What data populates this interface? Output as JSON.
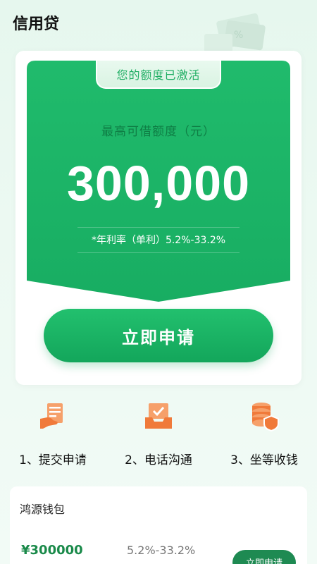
{
  "header": {
    "title": "信用贷"
  },
  "card": {
    "status_tab": "您的额度已激活",
    "limit_label": "最高可借额度（元）",
    "limit_amount": "300,000",
    "rate_text": "*年利率（单利）5.2%-33.2%",
    "apply_label": "立即申请"
  },
  "steps": [
    {
      "label": "1、提交申请",
      "icon": "document-hand-icon"
    },
    {
      "label": "2、电话沟通",
      "icon": "inbox-check-icon"
    },
    {
      "label": "3、坐等收钱",
      "icon": "coins-shield-icon"
    }
  ],
  "product": {
    "name": "鸿源钱包",
    "amount": "¥300000",
    "rate": "5.2%-33.2%",
    "apply_label": "立即申请"
  },
  "colors": {
    "primary_green": "#1ab366",
    "dark_green": "#0f7e45",
    "step_icon_orange": "#f07a3a"
  }
}
